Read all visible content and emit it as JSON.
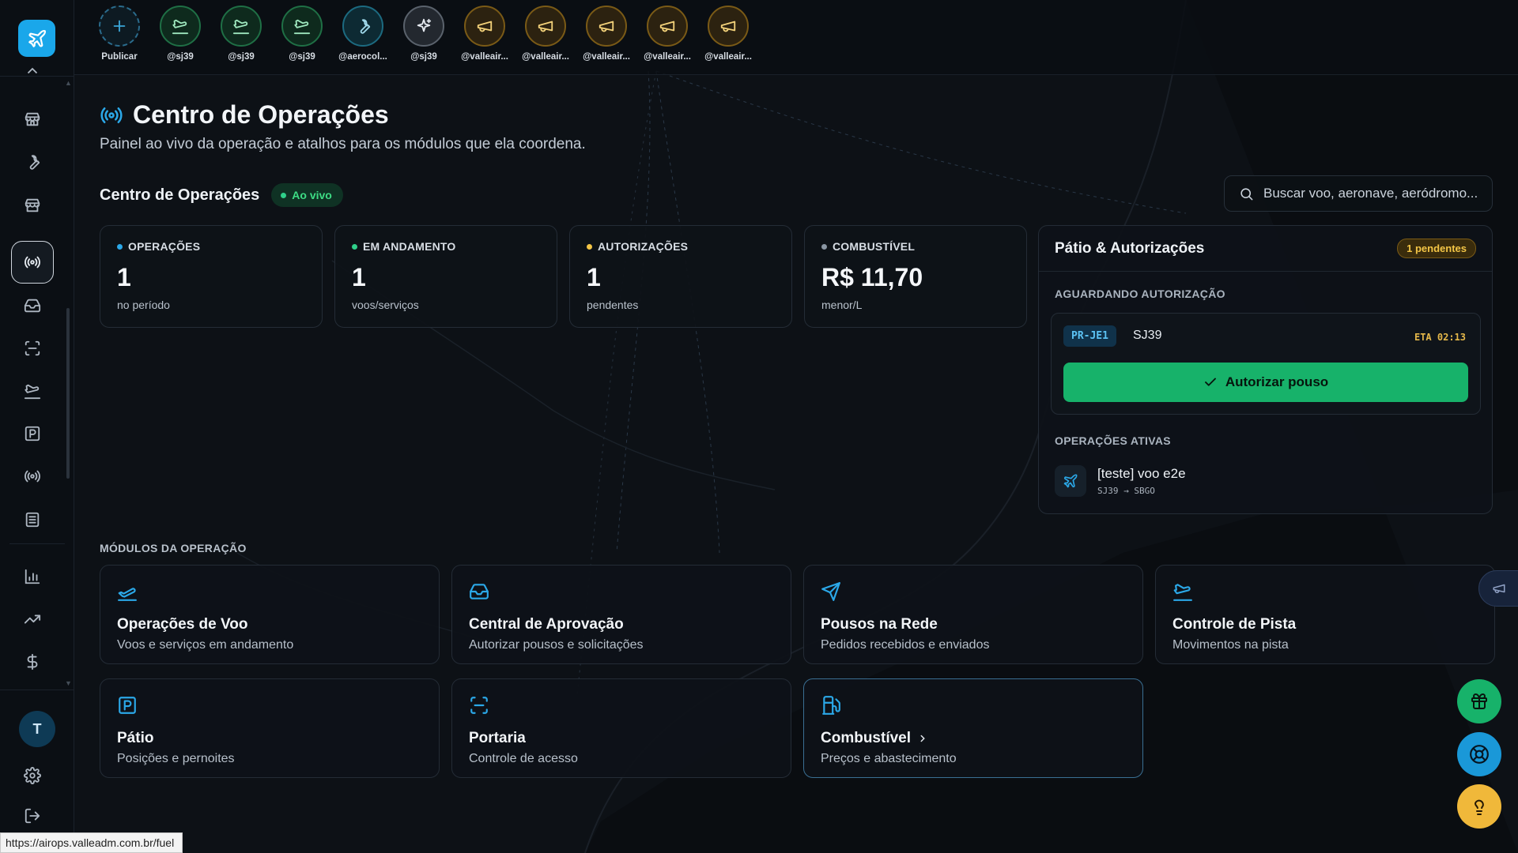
{
  "stories": [
    {
      "label": "Publicar",
      "icon": "plus-icon",
      "kind": "publish"
    },
    {
      "label": "@sj39",
      "icon": "plane-landing-icon",
      "kind": "green"
    },
    {
      "label": "@sj39",
      "icon": "plane-landing-icon",
      "kind": "green"
    },
    {
      "label": "@sj39",
      "icon": "plane-landing-icon",
      "kind": "green"
    },
    {
      "label": "@aerocol...",
      "icon": "wrench-icon",
      "kind": "teal"
    },
    {
      "label": "@sj39",
      "icon": "sparkles-icon",
      "kind": "gray"
    },
    {
      "label": "@valleair...",
      "icon": "megaphone-icon",
      "kind": "amber"
    },
    {
      "label": "@valleair...",
      "icon": "megaphone-icon",
      "kind": "amber"
    },
    {
      "label": "@valleair...",
      "icon": "megaphone-icon",
      "kind": "amber"
    },
    {
      "label": "@valleair...",
      "icon": "megaphone-icon",
      "kind": "amber"
    },
    {
      "label": "@valleair...",
      "icon": "megaphone-icon",
      "kind": "amber"
    }
  ],
  "sidebar": {
    "avatar_initial": "T",
    "icons": [
      "partial-icon",
      "store-icon",
      "wrench-icon",
      "store-icon",
      "radio-icon",
      "inbox-icon",
      "scan-icon",
      "plane-landing-icon",
      "parking-icon",
      "radio-icon",
      "list-icon",
      "bar-chart-icon",
      "trending-up-icon",
      "dollar-icon",
      "settings-icon",
      "logout-icon"
    ]
  },
  "page": {
    "title": "Centro de Operações",
    "subtitle": "Painel ao vivo da operação e atalhos para os módulos que ela coordena."
  },
  "section": {
    "title": "Centro de Operações",
    "live_label": "Ao vivo"
  },
  "search": {
    "placeholder": "Buscar voo, aeronave, aeródromo..."
  },
  "stats": [
    {
      "label": "OPERAÇÕES",
      "value": "1",
      "sub": "no período",
      "color": "#2ba8e8"
    },
    {
      "label": "EM ANDAMENTO",
      "value": "1",
      "sub": "voos/serviços",
      "color": "#2fd08a"
    },
    {
      "label": "AUTORIZAÇÕES",
      "value": "1",
      "sub": "pendentes",
      "color": "#f3c546"
    },
    {
      "label": "COMBUSTÍVEL",
      "value": "R$ 11,70",
      "sub": "menor/L",
      "color": "#8a96a3"
    }
  ],
  "panel": {
    "title": "Pátio & Autorizações",
    "badge": "1 pendentes",
    "awaiting_label": "AGUARDANDO AUTORIZAÇÃO",
    "auth": {
      "tail": "PR-JE1",
      "callsign": "SJ39",
      "eta": "ETA 02:13",
      "button": "Autorizar pouso"
    },
    "active_label": "OPERAÇÕES ATIVAS",
    "active": {
      "title": "[teste] voo e2e",
      "route": "SJ39 → SBGO"
    }
  },
  "modules_label": "MÓDULOS DA OPERAÇÃO",
  "modules": [
    {
      "title": "Operações de Voo",
      "sub": "Voos e serviços em andamento",
      "icon": "plane-takeoff-icon"
    },
    {
      "title": "Central de Aprovação",
      "sub": "Autorizar pousos e solicitações",
      "icon": "inbox-icon"
    },
    {
      "title": "Pousos na Rede",
      "sub": "Pedidos recebidos e enviados",
      "icon": "send-icon"
    },
    {
      "title": "Controle de Pista",
      "sub": "Movimentos na pista",
      "icon": "plane-landing-icon"
    },
    {
      "title": "Pátio",
      "sub": "Posições e pernoites",
      "icon": "parking-icon"
    },
    {
      "title": "Portaria",
      "sub": "Controle de acesso",
      "icon": "scan-icon"
    },
    {
      "title": "Combustível",
      "sub": "Preços e abastecimento",
      "icon": "fuel-icon"
    }
  ],
  "colors": {
    "accent": "#1aa7ea",
    "success": "#17b26a",
    "warning": "#f3c546"
  },
  "status_url": "https://airops.valleadm.com.br/fuel"
}
